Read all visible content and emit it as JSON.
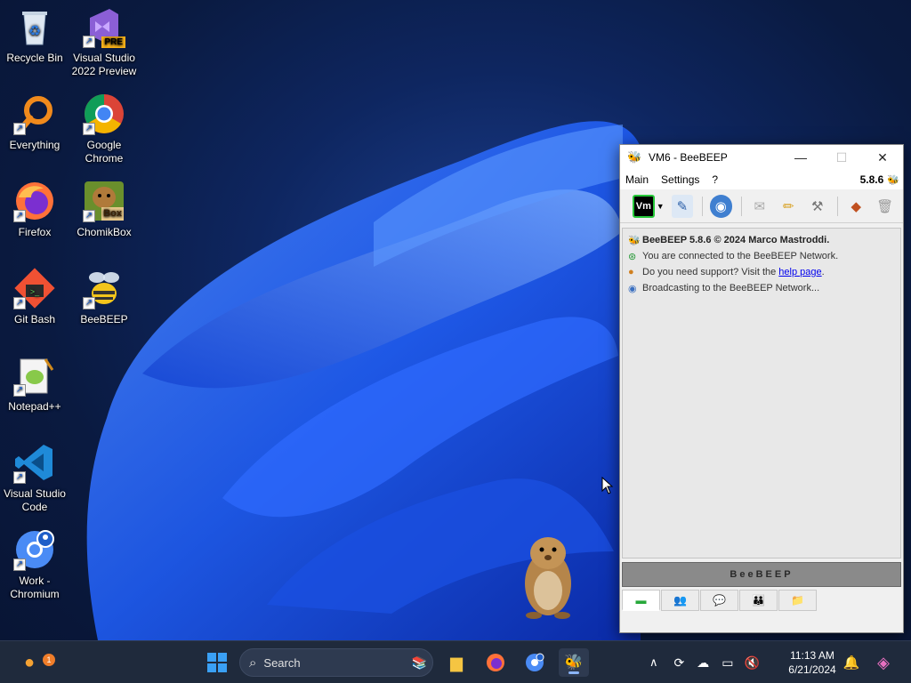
{
  "desktop": {
    "icons": [
      {
        "label": "Recycle Bin",
        "icon": "recycle-bin-icon"
      },
      {
        "label": "Visual Studio 2022 Preview",
        "icon": "visual-studio-icon",
        "badge": "PRE"
      },
      {
        "label": "Everything",
        "icon": "everything-search-icon"
      },
      {
        "label": "Google Chrome",
        "icon": "chrome-icon"
      },
      {
        "label": "Firefox",
        "icon": "firefox-icon"
      },
      {
        "label": "ChomikBox",
        "icon": "chomikbox-icon",
        "badge": "Box"
      },
      {
        "label": "Git Bash",
        "icon": "git-bash-icon"
      },
      {
        "label": "BeeBEEP",
        "icon": "beebeep-icon"
      },
      {
        "label": "Notepad++",
        "icon": "notepad-plus-plus-icon"
      },
      {
        "label": "Visual Studio Code",
        "icon": "vscode-icon"
      },
      {
        "label": "Work - Chromium",
        "icon": "chromium-profile-icon"
      }
    ]
  },
  "window": {
    "title": "VM6 - BeeBEEP",
    "controls": {
      "minimize": "—",
      "maximize": "☐",
      "close": "✕"
    },
    "menu": [
      "Main",
      "Settings",
      "?"
    ],
    "version": "5.8.6",
    "toolbar_vm_label": "Vm",
    "messages": [
      {
        "text": "BeeBEEP 5.8.6 © 2024 Marco Mastroddi.",
        "icon": "bee-icon"
      },
      {
        "text": "You are connected to the BeeBEEP Network.",
        "icon": "network-icon"
      },
      {
        "text_before": "Do you need support? Visit the ",
        "link": "help page",
        "text_after": ".",
        "icon": "support-icon"
      },
      {
        "text": "Broadcasting to the BeeBEEP Network...",
        "icon": "broadcast-icon"
      }
    ],
    "banner": "BeeBEEP",
    "colors": {
      "accent": "#27c83a",
      "banner": "#8a8a8a"
    }
  },
  "taskbar": {
    "search_placeholder": "Search",
    "notification_badge": "1",
    "clock_time": "11:13 AM",
    "clock_date": "6/21/2024"
  }
}
